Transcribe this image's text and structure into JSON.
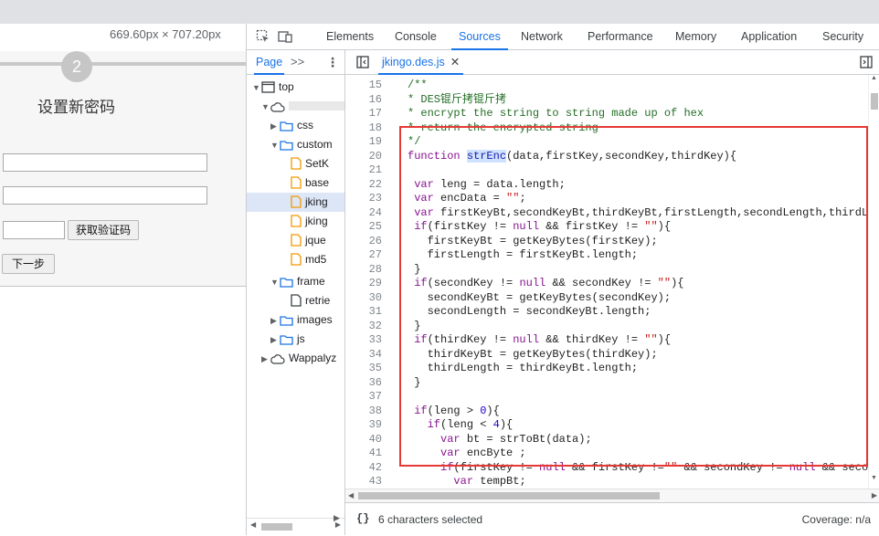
{
  "page": {
    "dimension_tip": "669.60px × 707.20px",
    "step_number": "2",
    "title": "设置新密码",
    "verify_button": "获取验证码",
    "next_button": "下一步"
  },
  "devtools": {
    "tabs": [
      {
        "label": "Elements"
      },
      {
        "label": "Console"
      },
      {
        "label": "Sources"
      },
      {
        "label": "Network"
      },
      {
        "label": "Performance"
      },
      {
        "label": "Memory"
      },
      {
        "label": "Application"
      },
      {
        "label": "Security"
      }
    ],
    "active_tab": "Sources",
    "navigator": {
      "tab": "Page",
      "more": ">>",
      "menu": "⋮",
      "tree": [
        {
          "label": "top",
          "type": "frame",
          "expanded": true
        },
        {
          "label": "",
          "type": "cloud",
          "expanded": true
        },
        {
          "label": "css",
          "type": "folder",
          "expanded": false
        },
        {
          "label": "custom",
          "type": "folder",
          "expanded": true
        },
        {
          "label": "SetK",
          "type": "file"
        },
        {
          "label": "base",
          "type": "file"
        },
        {
          "label": "jking",
          "type": "file",
          "selected": true
        },
        {
          "label": "jking",
          "type": "file"
        },
        {
          "label": "jque",
          "type": "file"
        },
        {
          "label": "md5",
          "type": "file"
        },
        {
          "label": "frame",
          "type": "folder",
          "expanded": true
        },
        {
          "label": "retrie",
          "type": "file-plain"
        },
        {
          "label": "images",
          "type": "folder",
          "expanded": false
        },
        {
          "label": "js",
          "type": "folder",
          "expanded": false
        },
        {
          "label": "Wappalyz",
          "type": "cloud",
          "expanded": false
        }
      ]
    },
    "editor": {
      "file_tab": "jkingo.des.js",
      "close": "✕",
      "lines": [
        {
          "n": "15",
          "text": "/**"
        },
        {
          "n": "16",
          "text": "* DES锟斤拷锟斤拷"
        },
        {
          "n": "17",
          "text": "* encrypt the string to string made up of hex"
        },
        {
          "n": "18",
          "text": "* return the encrypted string"
        },
        {
          "n": "19",
          "text": "*/"
        },
        {
          "n": "20",
          "text": "function strEnc(data,firstKey,secondKey,thirdKey){"
        },
        {
          "n": "21",
          "text": ""
        },
        {
          "n": "22",
          "text": " var leng = data.length;"
        },
        {
          "n": "23",
          "text": " var encData = \"\";"
        },
        {
          "n": "24",
          "text": " var firstKeyBt,secondKeyBt,thirdKeyBt,firstLength,secondLength,thirdLen"
        },
        {
          "n": "25",
          "text": " if(firstKey != null && firstKey != \"\"){"
        },
        {
          "n": "26",
          "text": "   firstKeyBt = getKeyBytes(firstKey);"
        },
        {
          "n": "27",
          "text": "   firstLength = firstKeyBt.length;"
        },
        {
          "n": "28",
          "text": " }"
        },
        {
          "n": "29",
          "text": " if(secondKey != null && secondKey != \"\"){"
        },
        {
          "n": "30",
          "text": "   secondKeyBt = getKeyBytes(secondKey);"
        },
        {
          "n": "31",
          "text": "   secondLength = secondKeyBt.length;"
        },
        {
          "n": "32",
          "text": " }"
        },
        {
          "n": "33",
          "text": " if(thirdKey != null && thirdKey != \"\"){"
        },
        {
          "n": "34",
          "text": "   thirdKeyBt = getKeyBytes(thirdKey);"
        },
        {
          "n": "35",
          "text": "   thirdLength = thirdKeyBt.length;"
        },
        {
          "n": "36",
          "text": " }"
        },
        {
          "n": "37",
          "text": ""
        },
        {
          "n": "38",
          "text": " if(leng > 0){"
        },
        {
          "n": "39",
          "text": "   if(leng < 4){"
        },
        {
          "n": "40",
          "text": "     var bt = strToBt(data);"
        },
        {
          "n": "41",
          "text": "     var encByte ;"
        },
        {
          "n": "42",
          "text": "     if(firstKey != null && firstKey !=\"\" && secondKey != null && second"
        },
        {
          "n": "43",
          "text": "       var tempBt;"
        }
      ]
    },
    "status": {
      "braces": "{}",
      "selection": "6 characters selected",
      "coverage": "Coverage: n/a"
    }
  }
}
